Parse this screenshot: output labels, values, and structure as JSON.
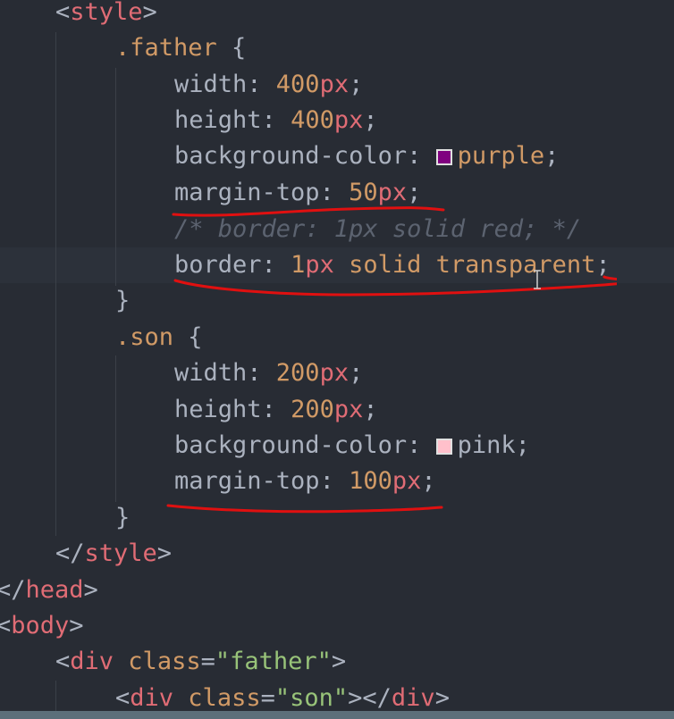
{
  "code": {
    "l1": {
      "lt": "<",
      "tag": "style",
      "gt": ">"
    },
    "l2": {
      "selector": ".father",
      "brace": " {"
    },
    "l3": {
      "prop": "width",
      "colon": ": ",
      "num": "400",
      "unit": "px",
      "semi": ";"
    },
    "l4": {
      "prop": "height",
      "colon": ": ",
      "num": "400",
      "unit": "px",
      "semi": ";"
    },
    "l5": {
      "prop": "background-color",
      "colon": ": ",
      "value": "purple",
      "semi": ";",
      "swatch_color": "#800080"
    },
    "l6": {
      "prop": "margin-top",
      "colon": ": ",
      "num": "50",
      "unit": "px",
      "semi": ";"
    },
    "l7": {
      "comment": "/* border: 1px solid red; */"
    },
    "l8": {
      "prop": "border",
      "colon": ": ",
      "num": "1",
      "unit": "px",
      "rest": " solid transparent",
      "semi": ";"
    },
    "l9": {
      "brace": "}"
    },
    "l10": {
      "selector": ".son",
      "brace": " {"
    },
    "l11": {
      "prop": "width",
      "colon": ": ",
      "num": "200",
      "unit": "px",
      "semi": ";"
    },
    "l12": {
      "prop": "height",
      "colon": ": ",
      "num": "200",
      "unit": "px",
      "semi": ";"
    },
    "l13": {
      "prop": "background-color",
      "colon": ": ",
      "value": "pink",
      "semi": ";",
      "swatch_color": "#ffc0cb"
    },
    "l14": {
      "prop": "margin-top",
      "colon": ": ",
      "num": "100",
      "unit": "px",
      "semi": ";"
    },
    "l15": {
      "brace": "}"
    },
    "l16": {
      "lt": "</",
      "tag": "style",
      "gt": ">"
    },
    "l17": {
      "lt": "</",
      "tag": "head",
      "gt": ">"
    },
    "l18": {
      "lt": "<",
      "tag": "body",
      "gt": ">"
    },
    "l19": {
      "lt": "<",
      "tag": "div",
      "attr": " class",
      "eq": "=",
      "str": "\"father\"",
      "gt": ">"
    },
    "l20": {
      "lt": "<",
      "tag": "div",
      "attr": " class",
      "eq": "=",
      "str": "\"son\"",
      "gt": "></",
      "tag2": "div",
      "gt2": ">"
    }
  },
  "colors": {
    "background": "#282c34",
    "annotation_red": "#e01010",
    "tag": "#e06c75",
    "number": "#d19a66",
    "string": "#98c379",
    "comment": "#5c6370"
  }
}
